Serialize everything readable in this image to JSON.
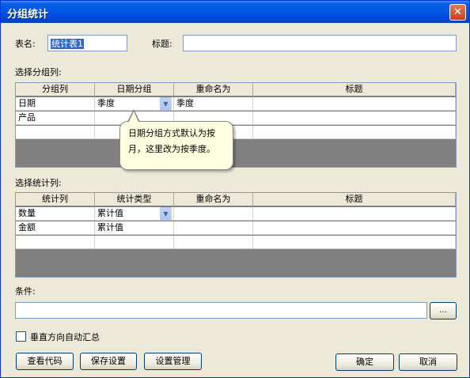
{
  "window": {
    "title": "分组统计",
    "close_glyph": "✕"
  },
  "form": {
    "table_name_label": "表名:",
    "table_name_value": "统计表1",
    "title_label": "标题:",
    "title_value": ""
  },
  "group_section": {
    "label": "选择分组列:",
    "headers": [
      "分组列",
      "日期分组",
      "重命名为",
      "标题"
    ],
    "rows": [
      [
        "日期",
        "季度",
        "季度",
        ""
      ],
      [
        "产品",
        "",
        "",
        ""
      ],
      [
        "",
        "",
        "",
        ""
      ]
    ]
  },
  "tooltip": {
    "line1": "日期分组方式默认为按",
    "line2": "月，这里改为按季度。"
  },
  "stat_section": {
    "label": "选择统计列:",
    "headers": [
      "统计列",
      "统计类型",
      "重命名为",
      "标题"
    ],
    "rows": [
      [
        "数量",
        "累计值",
        "",
        ""
      ],
      [
        "金额",
        "累计值",
        "",
        ""
      ],
      [
        "",
        "",
        "",
        ""
      ]
    ]
  },
  "condition": {
    "label": "条件:",
    "value": "",
    "browse_label": "..."
  },
  "checkbox": {
    "label": "垂直方向自动汇总",
    "checked": false
  },
  "buttons": {
    "view_code": "查看代码",
    "save_settings": "保存设置",
    "manage_settings": "设置管理",
    "ok": "确定",
    "cancel": "取消"
  },
  "dropdown_glyph": "▼"
}
